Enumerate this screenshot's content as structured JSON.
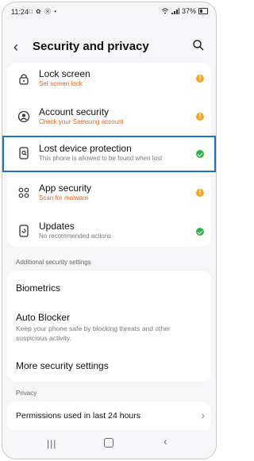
{
  "status_bar": {
    "time": "11:24",
    "left_icons": "□ ✿ Ⓡ •",
    "battery_text": "37%"
  },
  "header": {
    "title": "Security and privacy"
  },
  "security_items": [
    {
      "title": "Lock screen",
      "subtitle": "Set screen lock",
      "subtitle_color": "orange",
      "status": "warning"
    },
    {
      "title": "Account security",
      "subtitle": "Check your Samsung account",
      "subtitle_color": "orange",
      "status": "warning"
    },
    {
      "title": "Lost device protection",
      "subtitle": "This phone is allowed to be found when lost",
      "subtitle_color": "gray",
      "status": "ok"
    },
    {
      "title": "App security",
      "subtitle": "Scan for malware",
      "subtitle_color": "orange",
      "status": "warning"
    },
    {
      "title": "Updates",
      "subtitle": "No recommended actions",
      "subtitle_color": "gray",
      "status": "ok"
    }
  ],
  "additional": {
    "section_label": "Additional security settings",
    "biometrics": "Biometrics",
    "auto_blocker_title": "Auto Blocker",
    "auto_blocker_sub": "Keep your phone safe by blocking threats and other suspicious activity.",
    "more": "More security settings"
  },
  "privacy": {
    "section_label": "Privacy",
    "permissions": "Permissions used in last 24 hours"
  },
  "colors": {
    "accent_highlight": "#1a73c9",
    "warning": "#f5a623",
    "ok": "#2fb24a",
    "subtitle_warning": "#e8621f"
  }
}
